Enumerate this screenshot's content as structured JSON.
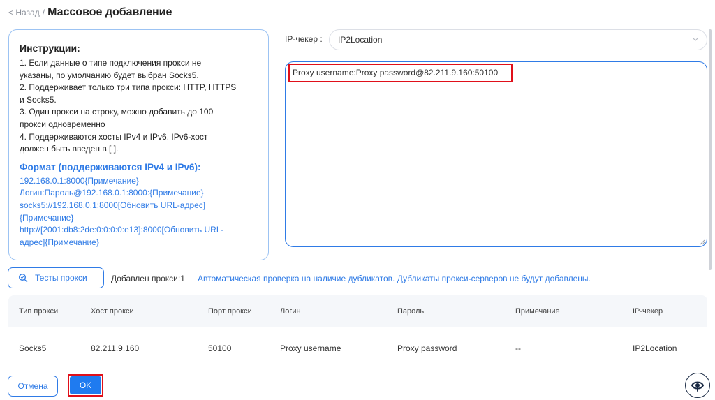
{
  "header": {
    "back_label": "< Назад",
    "separator": "/",
    "title": "Массовое добавление"
  },
  "instructions": {
    "title": "Инструкции:",
    "lines": [
      "1. Если данные о типе подключения прокси не",
      "указаны, по умолчанию будет выбран Socks5.",
      "2. Поддерживает только три типа прокси: HTTP, HTTPS",
      "и Socks5.",
      "3. Один прокси на строку, можно добавить до 100",
      "прокси одновременно",
      "4. Поддерживаются хосты IPv4 и IPv6. IPv6-хост",
      "должен быть введен в [ ]."
    ],
    "format_title": "Формат (поддерживаются IPv4 и IPv6):",
    "format_lines": [
      "192.168.0.1:8000{Примечание}",
      "Логин:Пароль@192.168.0.1:8000:{Примечание}",
      "socks5://192.168.0.1:8000[Обновить URL-адрес]",
      "{Примечание}",
      "http://[2001:db8:2de:0:0:0:0:e13]:8000[Обновить URL-",
      "адрес]{Примечание}"
    ]
  },
  "checker": {
    "label": "IP-чекер :",
    "selected": "IP2Location"
  },
  "proxy_input": {
    "value": "Proxy username:Proxy password@82.211.9.160:50100"
  },
  "actions": {
    "test_label": "Тесты прокси",
    "added_label": "Добавлен прокси:",
    "added_count": "1",
    "duplicate_note": "Автоматическая проверка на наличие дубликатов. Дубликаты прокси-серверов не будут добавлены."
  },
  "table": {
    "columns": [
      "Тип прокси",
      "Хост прокси",
      "Порт прокси",
      "Логин",
      "Пароль",
      "Примечание",
      "IP-чекер"
    ],
    "rows": [
      [
        "Socks5",
        "82.211.9.160",
        "50100",
        "Proxy username",
        "Proxy password",
        "--",
        "IP2Location"
      ]
    ]
  },
  "footer": {
    "cancel_label": "Отмена",
    "ok_label": "OK"
  },
  "icons": {
    "test": "search-icon",
    "chevron": "chevron-down-icon",
    "help": "eye-help-icon"
  },
  "colors": {
    "accent": "#2f7be6",
    "primary_button": "#1f7bf0",
    "highlight": "#e0101a"
  }
}
